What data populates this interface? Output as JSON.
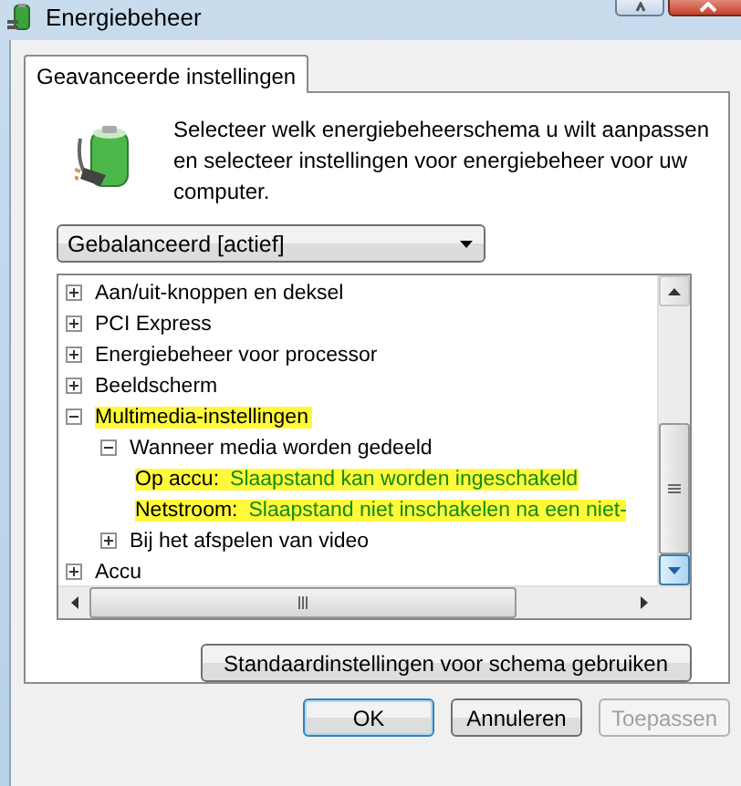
{
  "window": {
    "title": "Energiebeheer"
  },
  "tabs": [
    {
      "label": "Geavanceerde instellingen",
      "selected": true
    }
  ],
  "intro": "Selecteer welk energiebeheerschema u wilt aanpassen en selecteer instellingen voor energiebeheer voor uw computer.",
  "scheme_dropdown": {
    "value": "Gebalanceerd [actief]"
  },
  "tree": [
    {
      "label": "Aan/uit-knoppen en deksel",
      "expanded": false,
      "highlighted": false
    },
    {
      "label": "PCI Express",
      "expanded": false,
      "highlighted": false
    },
    {
      "label": "Energiebeheer voor processor",
      "expanded": false,
      "highlighted": false
    },
    {
      "label": "Beeldscherm",
      "expanded": false,
      "highlighted": false
    },
    {
      "label": "Multimedia-instellingen",
      "expanded": true,
      "highlighted": true,
      "children": [
        {
          "label": "Wanneer media worden gedeeld",
          "expanded": true,
          "highlighted": false,
          "children": [
            {
              "label": "Op accu:",
              "value": "Slaapstand kan worden ingeschakeld",
              "highlighted": true
            },
            {
              "label": "Netstroom:",
              "value": "Slaapstand niet inschakelen na een niet-",
              "highlighted": true
            }
          ]
        },
        {
          "label": "Bij het afspelen van video",
          "expanded": false,
          "highlighted": false
        }
      ]
    },
    {
      "label": "Accu",
      "expanded": false,
      "highlighted": false
    }
  ],
  "restore_button": "Standaardinstellingen voor schema gebruiken",
  "buttons": [
    {
      "label": "OK",
      "disabled": false
    },
    {
      "label": "Annuleren",
      "disabled": false
    },
    {
      "label": "Toepassen",
      "disabled": true
    }
  ]
}
